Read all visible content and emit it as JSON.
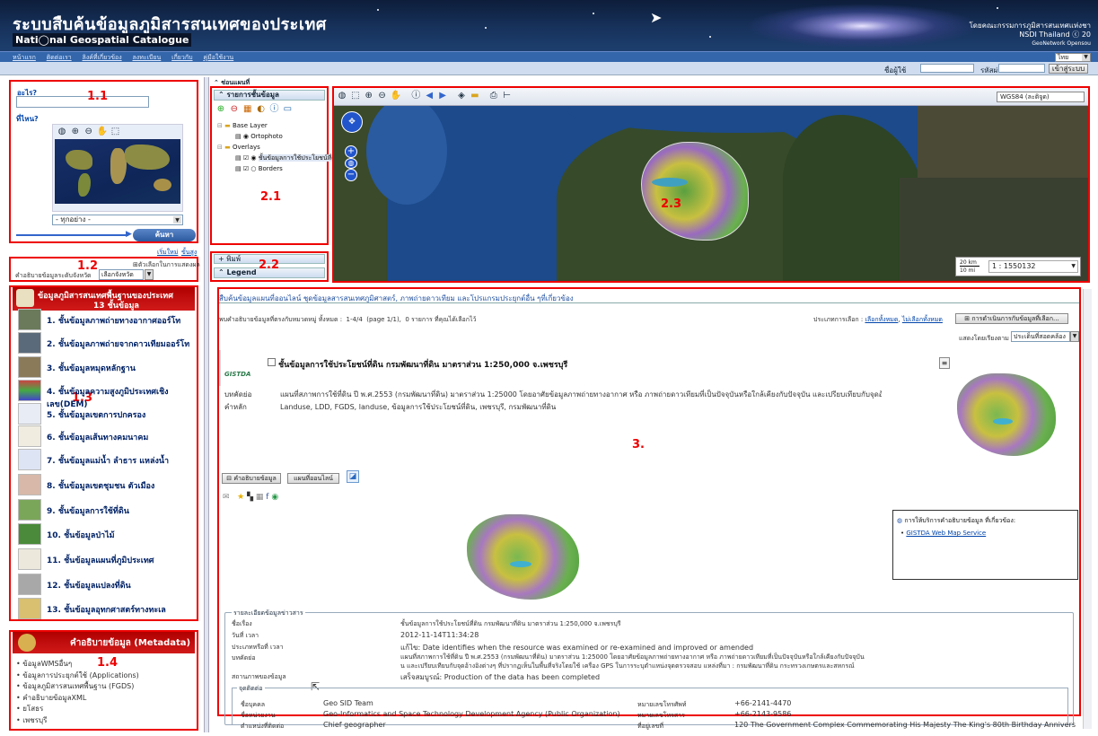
{
  "header": {
    "title_th": "ระบบสืบค้นข้อมูลภูมิสารสนเทศของประเทศ",
    "title_en": "Nati◯nal Geospatial Catalogue",
    "org_line1": "โดยคณะกรรมการภูมิสารสนเทศแห่งชา",
    "org_line2": "NSDI Thailand ⓒ 20",
    "org_line3": "GeoNetwork Opensou"
  },
  "nav": {
    "links": [
      "หน้าแรก",
      "ติดต่อเรา",
      "ลิงค์ที่เกี่ยวข้อง",
      "ลงทะเบียน",
      "เกี่ยวกับ",
      "คู่มือใช้งาน"
    ],
    "language": "ไทย"
  },
  "login": {
    "user_label": "ชื่อผู้ใช้",
    "password_label": "รหัสผ่าน",
    "login_button": "เข้าสู่ระบบ"
  },
  "search": {
    "what_label": "อะไร?",
    "where_label": "ที่ไหน?",
    "region_select": "- ทุกอย่าง -",
    "search_button": "ค้นหา",
    "reset_link": "เริ่มใหม่",
    "advanced_link": "ขั้นสูง",
    "options_toggle": "ตัวเลือกในการแสดงผล",
    "province_label": "คำอธิบายข้อมูลระดับจังหวัด",
    "province_select": "เลือกจังหวัด"
  },
  "categories": {
    "title": "ข้อมูลภูมิสารสนเทศพื้นฐานของประเทศ",
    "subtitle": "13 ชั้นข้อมูล",
    "items": [
      "1. ชั้นข้อมูลภาพถ่ายทางอากาศออร์โท",
      "2. ชั้นข้อมูลภาพถ่ายจากดาวเทียมออร์โท",
      "3. ชั้นข้อมูลหมุดหลักฐาน",
      "4. ชั้นข้อมูลความสูงภูมิประเทศเชิงเลข(DEM)",
      "5. ชั้นข้อมูลเขตการปกครอง",
      "6. ชั้นข้อมูลเส้นทางคมนาคม",
      "7. ชั้นข้อมูลแม่น้ำ ลำธาร แหล่งน้ำ",
      "8. ชั้นข้อมูลเขตชุมชน ตัวเมือง",
      "9. ชั้นข้อมูลการใช้ที่ดิน",
      "10. ชั้นข้อมูลป่าไม้",
      "11. ชั้นข้อมูลแผนที่ภูมิประเทศ",
      "12. ชั้นข้อมูลแปลงที่ดิน",
      "13. ชั้นข้อมูลอุทกศาสตร์ทางทะเล"
    ]
  },
  "metadata_box": {
    "title": "คำอธิบายข้อมูล (Metadata)",
    "items": [
      "ข้อมูลWMSอื่นๆ",
      "ข้อมูลการประยุกต์ใช้ (Applications)",
      "ข้อมูลภูมิสารสนเทศพื้นฐาน (FGDS)",
      "คำอธิบายข้อมูลXML",
      "ยโสธร",
      "เพชรบุรี"
    ]
  },
  "map_panel": {
    "toggle_label": "ซ่อนแผนที่",
    "layers_title": "รายการชั้นข้อมูล",
    "base_layer": "Base Layer",
    "ortophoto": "Ortophoto",
    "overlays": "Overlays",
    "overlay_layer": "ชั้นข้อมูลการใช้ประโยชน์ที่ดิน",
    "borders": "Borders",
    "print_label": "พิมพ์",
    "legend_label": "Legend",
    "projection": "WGS84 (ละติจูด)",
    "scale_km": "20 km",
    "scale_mi": "10 mi",
    "scale_value": "1 : 1550132"
  },
  "annotations": {
    "a11": "1.1",
    "a12": "1.2",
    "a13": "1.3",
    "a14": "1.4",
    "a21": "2.1",
    "a22": "2.2",
    "a23": "2.3",
    "a3": "3."
  },
  "results": {
    "heading": "สืบค้นข้อมูลแผนที่ออนไลน์ ชุดข้อมูลสารสนเทศภูมิศาสตร์, ภาพถ่ายดาวเทียม และโปรแกรมประยุกต์อื่น ๆที่เกี่ยวข้อง",
    "summary_prefix": "พบคำอธิบายข้อมูลที่ตรงกับหมวดหมู่ ทั้งหมด :",
    "summary_count": "1-4/4",
    "summary_page": "(page 1/1),",
    "summary_selected": "0 รายการ ที่คุณได้เลือกไว้",
    "selection_label": "ประเภทการเลือก :",
    "select_all": "เลือกทั้งหมด",
    "select_none": "ไม่เลือกทั้งหมด",
    "actions_button": "การดำเนินการกับข้อมูลที่เลือก...",
    "sort_label": "แสดงโดยเรียงตาม",
    "sort_value": "ประเด็นที่สอดคล้อง",
    "record_title": "ชั้นข้อมูลการใช้ประโยชน์ที่ดิน กรมพัฒนาที่ดิน มาตราส่วน 1:250,000 จ.เพชรบุรี",
    "agency_logo": "GISTDA",
    "abstract_label": "บทคัดย่อ",
    "abstract_text": "แผนที่สภาพการใช้ที่ดิน ปี พ.ศ.2553 (กรมพัฒนาที่ดิน) มาตราส่วน 1:25000 โดยอาศัยข้อมูลภาพถ่ายทางอากาศ หรือ ภาพถ่ายดาวเทียมที่เป็นปัจจุบันหรือใกล้เคียงกับปัจจุบัน และเปรียบเทียบกับจุดอ้างอิงต่างๆ ที่ป...",
    "keywords_label": "คำหลัก",
    "keywords_text": "Landuse, LDD, FGDS, landuse, ข้อมูลการใช้ประโยชน์ที่ดิน, เพชรบุรี, กรมพัฒนาที่ดิน",
    "tab_metadata": "คำอธิบายข้อมูล",
    "tab_online_map": "แผนที่ออนไลน์",
    "services_title": "การให้บริการคำอธิบายข้อมูล ที่เกี่ยวข้อง:",
    "services_link": "GISTDA Web Map Service"
  },
  "details": {
    "section_title": "รายละเอียดข้อมูลข่าวสาร",
    "rows": [
      {
        "label": "ชื่อเรื่อง",
        "value": "ชั้นข้อมูลการใช้ประโยชน์ที่ดิน กรมพัฒนาที่ดิน มาตราส่วน 1:250,000 จ.เพชรบุรี"
      },
      {
        "label": "วันที่ เวลา",
        "value": "2012-11-14T11:34:28"
      },
      {
        "label": "ประเภทหรือที่ เวลา",
        "value": "แก้ไข: Date identifies when the resource was examined or re-examined and improved or amended"
      },
      {
        "label": "บทคัดย่อ",
        "value": "แผนที่สภาพการใช้ที่ดิน ปี พ.ศ.2553 (กรมพัฒนาที่ดิน) มาตราส่วน 1:25000 โดยอาศัยข้อมูลภาพถ่ายทางอากาศ หรือ ภาพถ่ายดาวเทียมที่เป็นปัจจุบันหรือใกล้เคียงกับปัจจุบัน"
      },
      {
        "label": "",
        "value": "น และเปรียบเทียบกับจุดอ้างอิงต่างๆ ที่ปรากฏเห็นในพื้นที่จริงโดยใช้ เครื่อง GPS ในการระบุตำแหน่งจุดตรวจสอบ แหล่งที่มา : กรมพัฒนาที่ดิน กระทรวงเกษตรและสหกรณ์"
      },
      {
        "label": "สถานภาพของข้อมูล",
        "value": "เสร็จสมบูรณ์: Production of the data has been completed"
      }
    ],
    "contact_title": "จุดติดต่อ",
    "contact_rows": [
      {
        "label": "ชื่อบุคคล",
        "value": "Geo SID Team",
        "label2": "หมายเลขโทรศัพท์",
        "value2": "+66-2141-4470"
      },
      {
        "label": "ชื่อหน่วยงาน",
        "value": "Geo-Informatics and Space Technology Development Agency (Public Organization)",
        "label2": "หมายเลขโทรสาร",
        "value2": "+66-2143-9586"
      },
      {
        "label": "ตำแหน่งที่ติดต่อ",
        "value": "Chief geographer",
        "label2": "ที่อยู่เลขที่",
        "value2": "120 The Government Complex Commemorating His Majesty The King's 80th Birthday Anniversary,"
      }
    ]
  }
}
